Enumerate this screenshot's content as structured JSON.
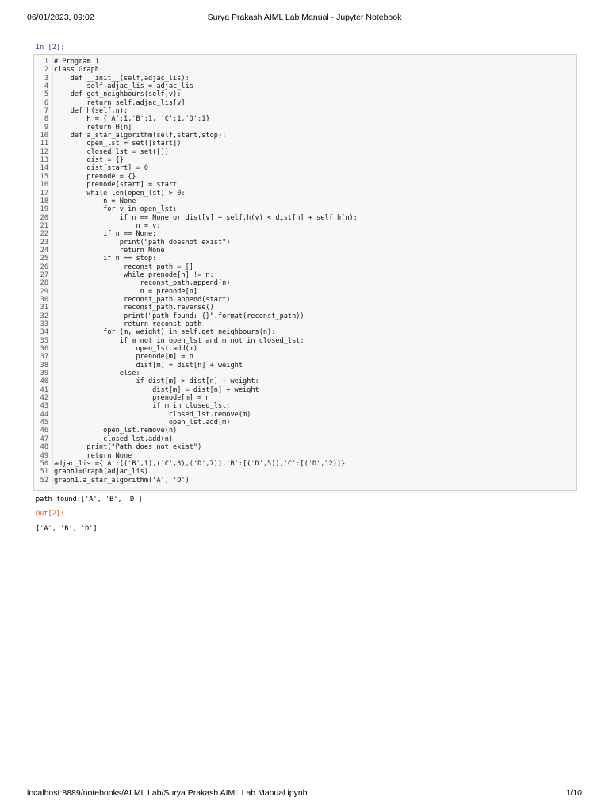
{
  "header": {
    "datetime": "06/01/2023, 09:02",
    "title": "Surya Prakash AIML Lab Manual - Jupyter Notebook"
  },
  "cell": {
    "in_prompt": "In [2]:",
    "code_lines": [
      "# Program 1",
      "class Graph:",
      "    def __init__(self,adjac_lis):",
      "        self.adjac_lis = adjac_lis",
      "    def get_neighbours(self,v):",
      "        return self.adjac_lis[v]",
      "    def h(self,n):",
      "        H = {'A':1,'B':1, 'C':1,'D':1}",
      "        return H[n]",
      "    def a_star_algorithm(self,start,stop):",
      "        open_lst = set([start])",
      "        closed_lst = set([])",
      "        dist = {}",
      "        dist[start] = 0",
      "        prenode = {}",
      "        prenode[start] = start",
      "        while len(open_lst) > 0:",
      "            n = None",
      "            for v in open_lst:",
      "                if n == None or dist[v] + self.h(v) < dist[n] + self.h(n):",
      "                    n = v;",
      "            if n == None:",
      "                print(\"path doesnot exist\")",
      "                return None",
      "            if n == stop:",
      "                 reconst_path = []",
      "                 while prenode[n] != n:",
      "                     reconst_path.append(n)",
      "                     n = prenode[n]",
      "                 reconst_path.append(start)",
      "                 reconst_path.reverse()",
      "                 print(\"path found: {}\".format(reconst_path))",
      "                 return reconst_path",
      "            for (m, weight) in self.get_neighbours(n):",
      "                if m not in open_lst and m not in closed_lst:",
      "                    open_lst.add(m)",
      "                    prenode[m] = n",
      "                    dist[m] = dist[n] + weight",
      "                else:",
      "                    if dist[m] > dist[n] + weight:",
      "                        dist[m] = dist[n] + weight",
      "                        prenode[m] = n",
      "                        if m in closed_lst:",
      "                            closed_lst.remove(m)",
      "                            open_lst.add(m)",
      "            open_lst.remove(n)",
      "            closed_lst.add(n)",
      "        print(\"Path does not exist\")",
      "        return None",
      "adjac_lis ={'A':[('B',1),('C',3),('D',7)],'B':[('D',5)],'C':[('D',12)]}",
      "graph1=Graph(adjac_lis)",
      "graph1.a_star_algorithm('A', 'D')"
    ],
    "stdout": "path found:['A', 'B', 'D']",
    "out_prompt": "Out[2]:",
    "result": "['A', 'B', 'D']"
  },
  "footer": {
    "url": "localhost:8889/notebooks/AI ML Lab/Surya Prakash AIML Lab Manual.ipynb",
    "page": "1/10"
  }
}
